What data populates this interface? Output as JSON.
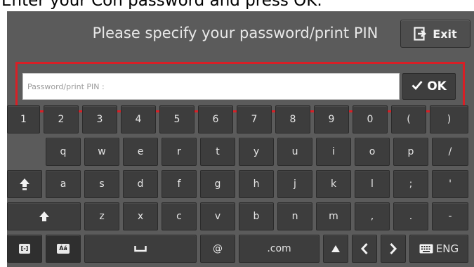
{
  "instruction": "Enter your Con password and press OK.",
  "header": {
    "title": "Please specify your password/print PIN",
    "exit_label": "Exit"
  },
  "input": {
    "placeholder": "Password/print PIN :",
    "value": ""
  },
  "ok_label": "OK",
  "keyboard": {
    "row1": [
      "1",
      "2",
      "3",
      "4",
      "5",
      "6",
      "7",
      "8",
      "9",
      "0",
      "(",
      ")"
    ],
    "row2": [
      "q",
      "w",
      "e",
      "r",
      "t",
      "y",
      "u",
      "i",
      "o",
      "p",
      "/"
    ],
    "row3": [
      "a",
      "s",
      "d",
      "f",
      "g",
      "h",
      "j",
      "k",
      "l",
      ";",
      "'"
    ],
    "row4": [
      "z",
      "x",
      "c",
      "v",
      "b",
      "n",
      "m",
      ",",
      ".",
      "-"
    ],
    "row5": {
      "hyphen_key": "[-]",
      "accent_key": "Áá",
      "at_key": "@",
      "com_key": ".com",
      "language": "ENG"
    }
  },
  "colors": {
    "background": "#5b5b5b",
    "key": "#3d3d3d",
    "highlight": "#d81f26"
  }
}
